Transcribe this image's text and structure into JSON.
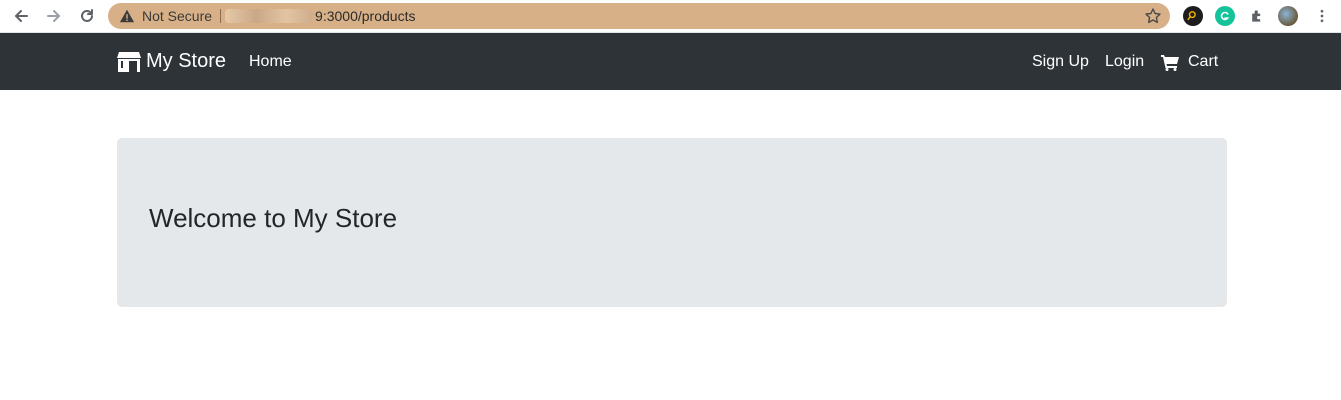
{
  "browser": {
    "security_label": "Not Secure",
    "url_visible": "9:3000/products",
    "colors": {
      "omnibox_bg": "#d8b088"
    },
    "icons": [
      "back-arrow-icon",
      "forward-arrow-icon",
      "reload-icon",
      "warning-triangle-icon",
      "bookmark-star-icon",
      "search-extension-icon",
      "grammarly-icon",
      "puzzle-extension-icon",
      "profile-avatar-icon",
      "kebab-menu-icon"
    ]
  },
  "navbar": {
    "brand_label": "My Store",
    "links": {
      "home": "Home",
      "signup": "Sign Up",
      "login": "Login",
      "cart": "Cart"
    },
    "colors": {
      "bg": "#2e3338",
      "text": "#ffffff"
    },
    "icons": {
      "brand": "store-icon",
      "cart": "shopping-cart-icon"
    }
  },
  "jumbotron": {
    "title": "Welcome to My Store",
    "colors": {
      "bg": "#e4e8eb"
    }
  }
}
